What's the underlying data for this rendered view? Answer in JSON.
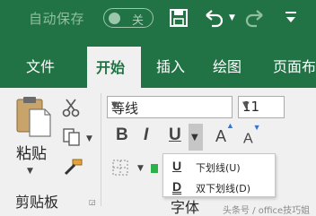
{
  "titlebar": {
    "autosave_label": "自动保存",
    "toggle_state": "关",
    "icons": [
      "save-icon",
      "undo-icon",
      "chevron-down-icon",
      "redo-icon",
      "quick-access-menu-icon"
    ],
    "color": "#217346"
  },
  "tabs": [
    {
      "label": "文件"
    },
    {
      "label": "开始",
      "active": true
    },
    {
      "label": "插入"
    },
    {
      "label": "绘图"
    },
    {
      "label": "页面布"
    }
  ],
  "clipboard": {
    "paste_label": "粘贴",
    "group_label": "剪贴板",
    "icons": [
      "paste-icon",
      "cut-icon",
      "copy-icon",
      "format-painter-icon",
      "dialog-launcher-icon"
    ]
  },
  "font": {
    "name": "等线",
    "size": "11",
    "bold": "B",
    "italic": "I",
    "underline": "U",
    "grow": "A",
    "shrink": "A",
    "group_label": "字体"
  },
  "underline_menu": {
    "items": [
      {
        "icon": "U",
        "label": "下划线(U)"
      },
      {
        "icon": "D",
        "label": "双下划线(D)"
      }
    ]
  },
  "watermark": "头条号 / office技巧姐"
}
